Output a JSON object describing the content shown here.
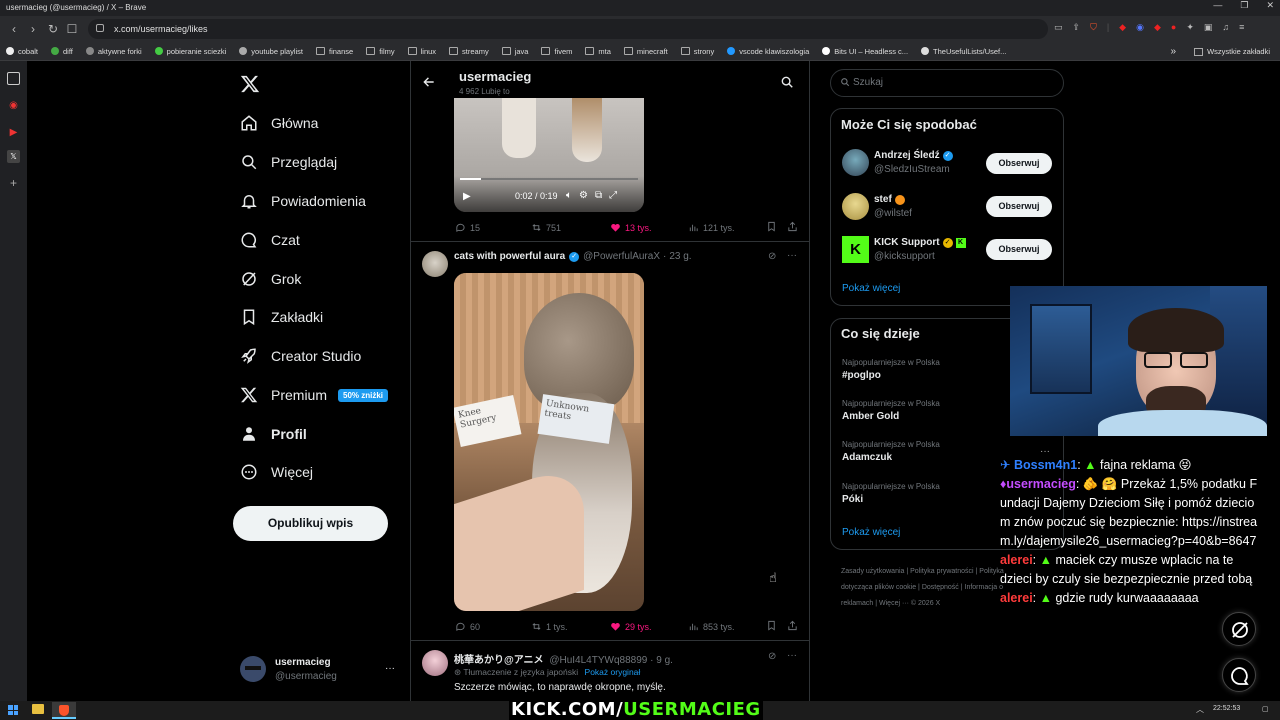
{
  "browser": {
    "window_title": "usermacieg (@usermacieg) / X – Brave",
    "url": "x.com/usermacieg/likes",
    "bookmarks": [
      "cobalt",
      "diff",
      "aktywne forki",
      "pobieranie sciezki",
      "youtube playlist",
      "finanse",
      "filmy",
      "linux",
      "streamy",
      "java",
      "fivem",
      "mta",
      "minecraft",
      "strony",
      "vscode klawiszologia",
      "Bits UI – Headless c...",
      "TheUsefulLists/Usef..."
    ],
    "bookmarks_overflow": "»",
    "bookmarks_other": "Wszystkie zakładki"
  },
  "x_nav": {
    "items": [
      {
        "label": "Główna",
        "icon": "home-icon"
      },
      {
        "label": "Przeglądaj",
        "icon": "search-icon"
      },
      {
        "label": "Powiadomienia",
        "icon": "bell-icon"
      },
      {
        "label": "Czat",
        "icon": "chat-icon"
      },
      {
        "label": "Grok",
        "icon": "grok-icon"
      },
      {
        "label": "Zakładki",
        "icon": "bookmark-icon"
      },
      {
        "label": "Creator Studio",
        "icon": "rocket-icon"
      },
      {
        "label": "Premium",
        "icon": "x-logo-icon"
      },
      {
        "label": "Profil",
        "icon": "person-icon"
      },
      {
        "label": "Więcej",
        "icon": "more-circle-icon"
      }
    ],
    "premium_badge": "50% zniżki",
    "publish_label": "Opublikuj wpis",
    "account_name": "usermacieg",
    "account_handle": "@usermacieg",
    "account_menu": "···"
  },
  "profile_header": {
    "name": "usermacieg",
    "likes_count": "4 962 Lubię to"
  },
  "video_player": {
    "time": "0:02 / 0:19"
  },
  "post1_actions": {
    "replies": "15",
    "reposts": "751",
    "likes": "13 tys.",
    "views": "121 tys."
  },
  "post2": {
    "author": "cats with powerful aura",
    "handle": "@PowerfulAuraX",
    "time": "23 g.",
    "card_left": "Knee Surgery",
    "card_right": "Unknown treats",
    "replies": "60",
    "reposts": "1 tys.",
    "likes": "29 tys.",
    "views": "853 tys."
  },
  "post3": {
    "author": "桃華あかり@アニメ",
    "handle": "@HuI4L4TYWq88899",
    "time": "9 g.",
    "translated": "Tłumaczenie z języka japoński",
    "show_original": "Pokaż oryginał",
    "text": "Szczerze mówiąc, to naprawdę okropne, myślę."
  },
  "right": {
    "search_placeholder": "Szukaj",
    "suggest_title": "Może Ci się spodobać",
    "suggestions": [
      {
        "name": "Andrzej Śledź",
        "handle": "@SledzIuStream"
      },
      {
        "name": "stef",
        "handle": "@wilstef"
      },
      {
        "name": "KICK Support",
        "handle": "@kicksupport"
      }
    ],
    "follow_label": "Obserwuj",
    "show_more": "Pokaż więcej",
    "trends_title": "Co się dzieje",
    "trend_category": "Najpopularniejsze w Polska",
    "trends": [
      "#poglpo",
      "Amber Gold",
      "Adamczuk",
      "Póki"
    ],
    "footer_links": [
      "Zasady użytkowania",
      "Polityka prywatności",
      "Polityka dotycząca plików cookie",
      "Dostępność",
      "Informacja o reklamach",
      "Więcej ···",
      "© 2026 X"
    ]
  },
  "chat": {
    "messages": [
      {
        "user": "Bossm4n1",
        "text": "fajna reklama 😝"
      },
      {
        "user": "usermacieg",
        "text": "🫵 🤗 Przekaż 1,5% podatku Fundacji Dajemy Dzieciom Siłę i pomóż dzieciom znów poczuć się bezpiecznie: https://instream.ly/dajemysile26_usermacieg?p=40&b=8647"
      },
      {
        "user": "alerei",
        "text": "maciek czy musze wplacic na te dzieci by czuly sie bezpezpiecznie przed tobą"
      },
      {
        "user": "alerei",
        "text": "gdzie rudy kurwaaaaaaaa"
      }
    ]
  },
  "overlay": {
    "kick_prefix": "KICK.COM/",
    "kick_user": "USERMACIEG"
  },
  "taskbar": {
    "time": "22:52:53"
  },
  "colors": {
    "accent": "#1d9bf0",
    "like": "#f91880",
    "kick": "#53fc18",
    "chat_user1": "#2f80ff",
    "chat_user2": "#c44dff",
    "chat_user3": "#ff3b3b"
  }
}
